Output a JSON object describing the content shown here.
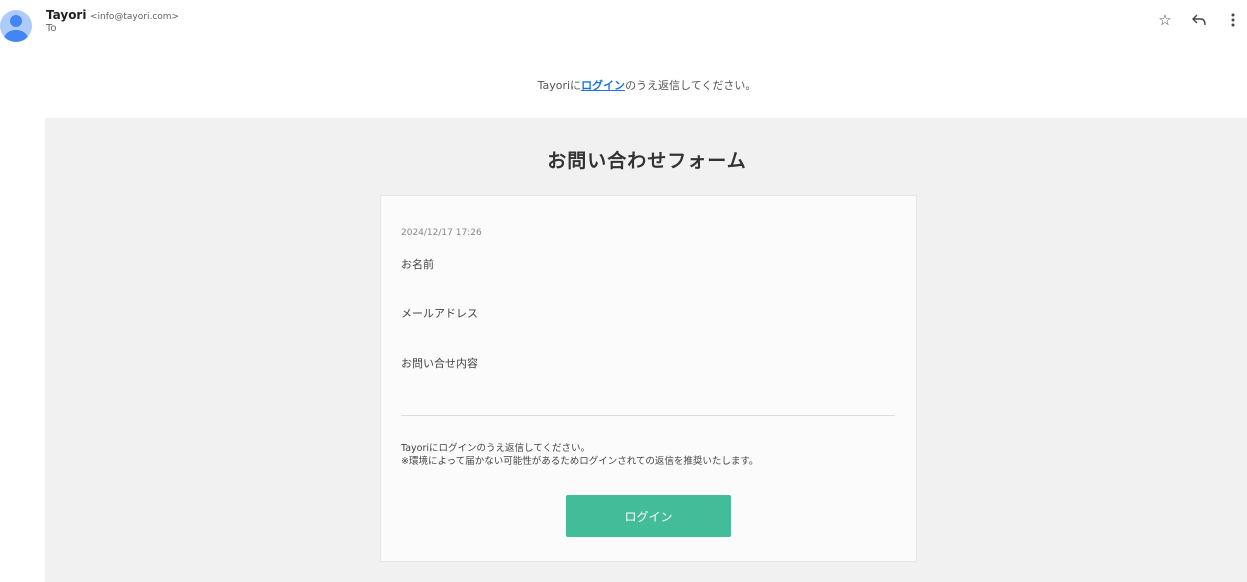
{
  "sender": {
    "name": "Tayori",
    "address": "<info@tayori.com>",
    "to_label": "To"
  },
  "icons": [
    "star-icon",
    "reply-icon",
    "more-vertical-icon"
  ],
  "top_note": {
    "prefix": "Tayoriに",
    "link": "ログイン",
    "suffix": "のうえ返信してください。"
  },
  "form": {
    "title": "お問い合わせフォーム",
    "date": "2024/12/17 17:26",
    "fields": [
      "お名前",
      "メールアドレス",
      "お問い合せ内容"
    ],
    "note_line1": "Tayoriにログインのうえ返信してください。",
    "note_line2": "※環境によって届かない可能性があるためログインされての返信を推奨いたします。",
    "login_button": "ログイン"
  },
  "colors": {
    "accent": "#43bc9a",
    "link": "#1a73e8",
    "background": "#f1f1f1"
  }
}
